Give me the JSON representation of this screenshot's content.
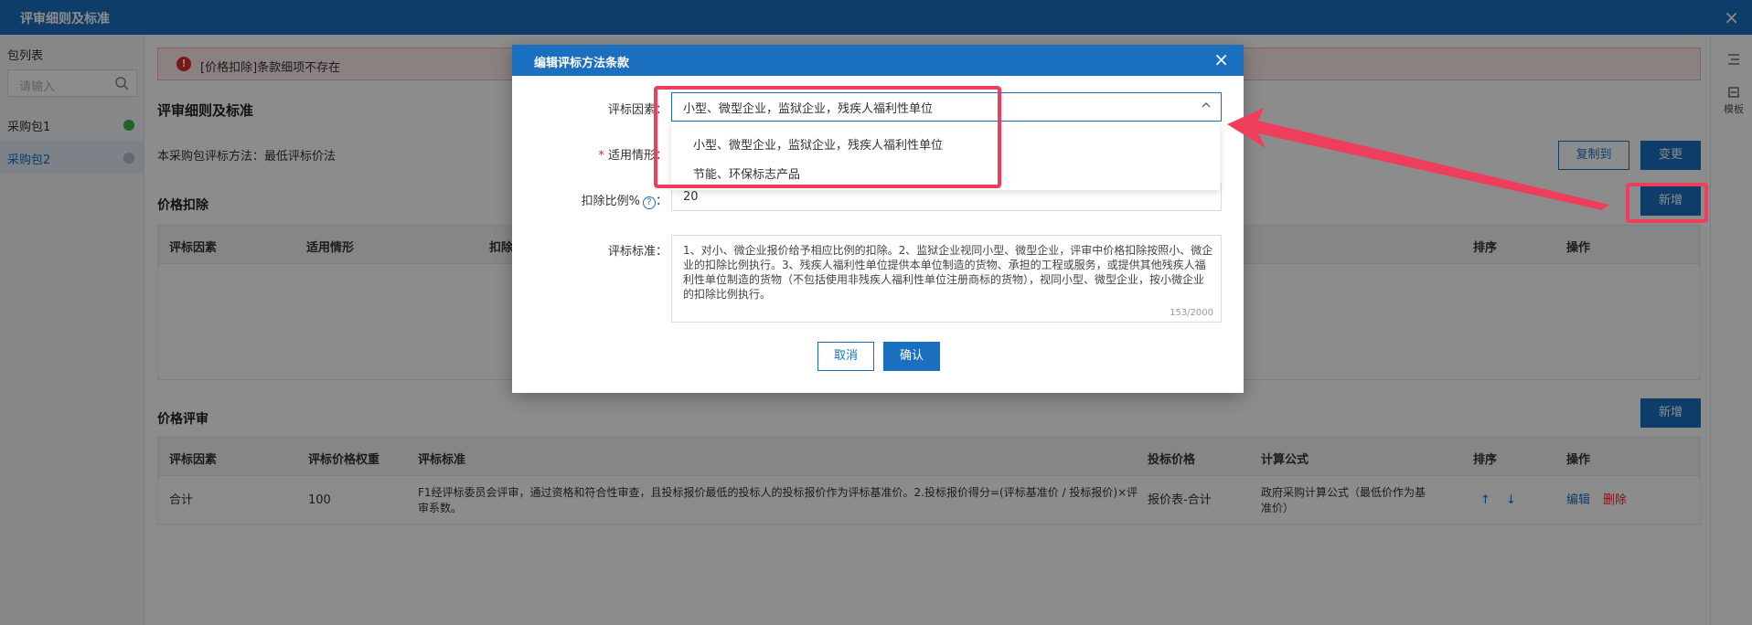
{
  "window": {
    "title": "评审细则及标准",
    "close_glyph": "×"
  },
  "sidebar": {
    "title": "包列表",
    "search_placeholder": "请输入",
    "items": [
      {
        "label": "采购包1",
        "status_color": "#3cb34a"
      },
      {
        "label": "采购包2",
        "status_color": "#b8bec6"
      }
    ]
  },
  "right_rail": {
    "template_label": "模板"
  },
  "main": {
    "alert_icon": "!",
    "alert_text": "[价格扣除]条款细项不存在",
    "section_title": "评审细则及标准",
    "method_label": "本采购包评标方法：最低评标价法",
    "copy_to_button": "复制到",
    "change_button": "变更",
    "price_deduction": {
      "title": "价格扣除",
      "add_button": "新增",
      "columns": [
        "评标因素",
        "适用情形",
        "扣除",
        "排序",
        "操作"
      ]
    },
    "price_review": {
      "title": "价格评审",
      "add_button": "新增",
      "columns": [
        "评标因素",
        "评标价格权重",
        "评标标准",
        "投标价格",
        "计算公式",
        "排序",
        "操作"
      ],
      "rows": [
        {
          "factor": "合计",
          "weight": "100",
          "standard": "F1经评标委员会评审，通过资格和符合性审查，且投标报价最低的投标人的投标报价作为评标基准价。2.投标报价得分=(评标基准价 / 投标报价)×评审系数。",
          "bid_price": "报价表-合计",
          "formula": "政府采购计算公式（最低价作为基准价）",
          "sort_up": "↑",
          "sort_down": "↓",
          "edit": "编辑",
          "delete": "删除"
        }
      ]
    }
  },
  "modal": {
    "title": "编辑评标方法条款",
    "close_glyph": "×",
    "factor_label": "评标因素：",
    "factor_value": "小型、微型企业，监狱企业，残疾人福利性单位",
    "factor_options": [
      "小型、微型企业，监狱企业，残疾人福利性单位",
      "节能、环保标志产品"
    ],
    "scenario_label": "适用情形：",
    "ratio_label": "扣除比例%",
    "ratio_help": "?",
    "ratio_colon": "：",
    "ratio_value": "20",
    "standard_label": "评标标准：",
    "standard_value": "1、对小、微企业报价给予相应比例的扣除。2、监狱企业视同小型、微型企业，评审中价格扣除按照小、微企业的扣除比例执行。3、残疾人福利性单位提供本单位制造的货物、承担的工程或服务，或提供其他残疾人福利性单位制造的货物（不包括使用非残疾人福利性单位注册商标的货物），视同小型、微型企业，按小微企业的扣除比例执行。",
    "char_count": "153/2000",
    "cancel_button": "取消",
    "confirm_button": "确认"
  },
  "annotation_color": "#ef3e5c"
}
